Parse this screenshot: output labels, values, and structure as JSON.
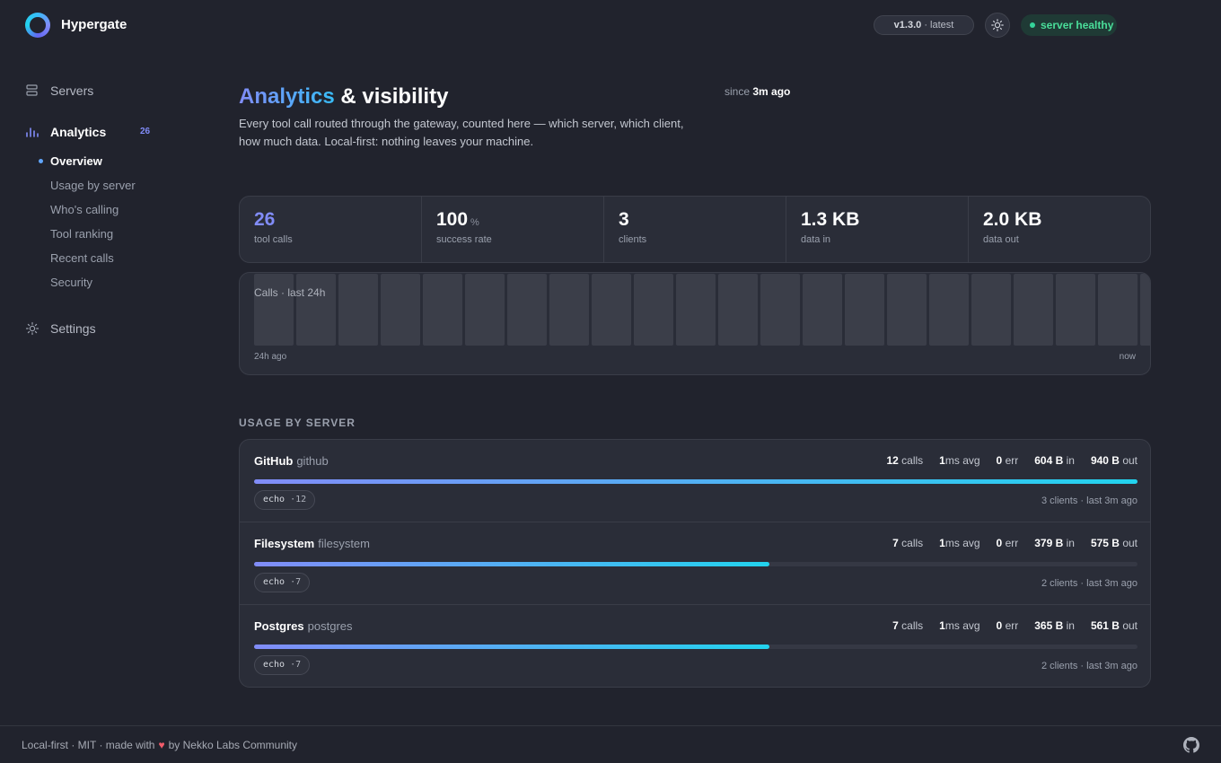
{
  "app": {
    "name": "Hypergate"
  },
  "header": {
    "version": "v1.3.0",
    "version_tag": "· latest",
    "status": "server healthy"
  },
  "sidebar": {
    "servers": "Servers",
    "analytics": "Analytics",
    "analytics_badge": "26",
    "sub": [
      "Overview",
      "Usage by server",
      "Who's calling",
      "Tool ranking",
      "Recent calls",
      "Security"
    ],
    "settings": "Settings"
  },
  "hero": {
    "title_accent": "Analytics",
    "title_rest": " & visibility",
    "since_prefix": "since ",
    "since_value": "3m ago",
    "description": "Every tool call routed through the gateway, counted here — which server, which client, how much data. Local-first: nothing leaves your machine."
  },
  "stats": [
    {
      "value": "26",
      "unit": "",
      "label": "tool calls"
    },
    {
      "value": "100",
      "unit": "%",
      "label": "success rate"
    },
    {
      "value": "3",
      "unit": "",
      "label": "clients"
    },
    {
      "value": "1.3 KB",
      "unit": "",
      "label": "data in"
    },
    {
      "value": "2.0 KB",
      "unit": "",
      "label": "data out"
    }
  ],
  "calls_chart": {
    "label": "Calls · last 24h",
    "left_label": "24h ago",
    "right_label": "now"
  },
  "usage": {
    "heading": "USAGE BY SERVER",
    "servers": [
      {
        "name": "GitHub",
        "id": "github",
        "calls": "12",
        "avg": "1",
        "err": "0",
        "in": "604 B",
        "out": "940 B",
        "share": 1.0,
        "tool": "echo",
        "tool_count": "·12",
        "footer": "3 clients · last 3m ago"
      },
      {
        "name": "Filesystem",
        "id": "filesystem",
        "calls": "7",
        "avg": "1",
        "err": "0",
        "in": "379 B",
        "out": "575 B",
        "share": 0.5833,
        "tool": "echo",
        "tool_count": "·7",
        "footer": "2 clients · last 3m ago"
      },
      {
        "name": "Postgres",
        "id": "postgres",
        "calls": "7",
        "avg": "1",
        "err": "0",
        "in": "365 B",
        "out": "561 B",
        "share": 0.5833,
        "tool": "echo",
        "tool_count": "·7",
        "footer": "2 clients · last 3m ago"
      }
    ],
    "calls_unit": " calls",
    "avg_unit": "ms avg",
    "err_unit": " err",
    "in_unit": " in",
    "out_unit": " out"
  },
  "footer": {
    "text_before": "Local-first · MIT · made with",
    "heart": "♥",
    "text_after": "by Nekko Labs Community"
  },
  "icons": {
    "servers": "server-stack-icon",
    "analytics": "bar-chart-icon",
    "settings": "gear-icon",
    "theme": "sun-icon",
    "github": "github-icon"
  }
}
